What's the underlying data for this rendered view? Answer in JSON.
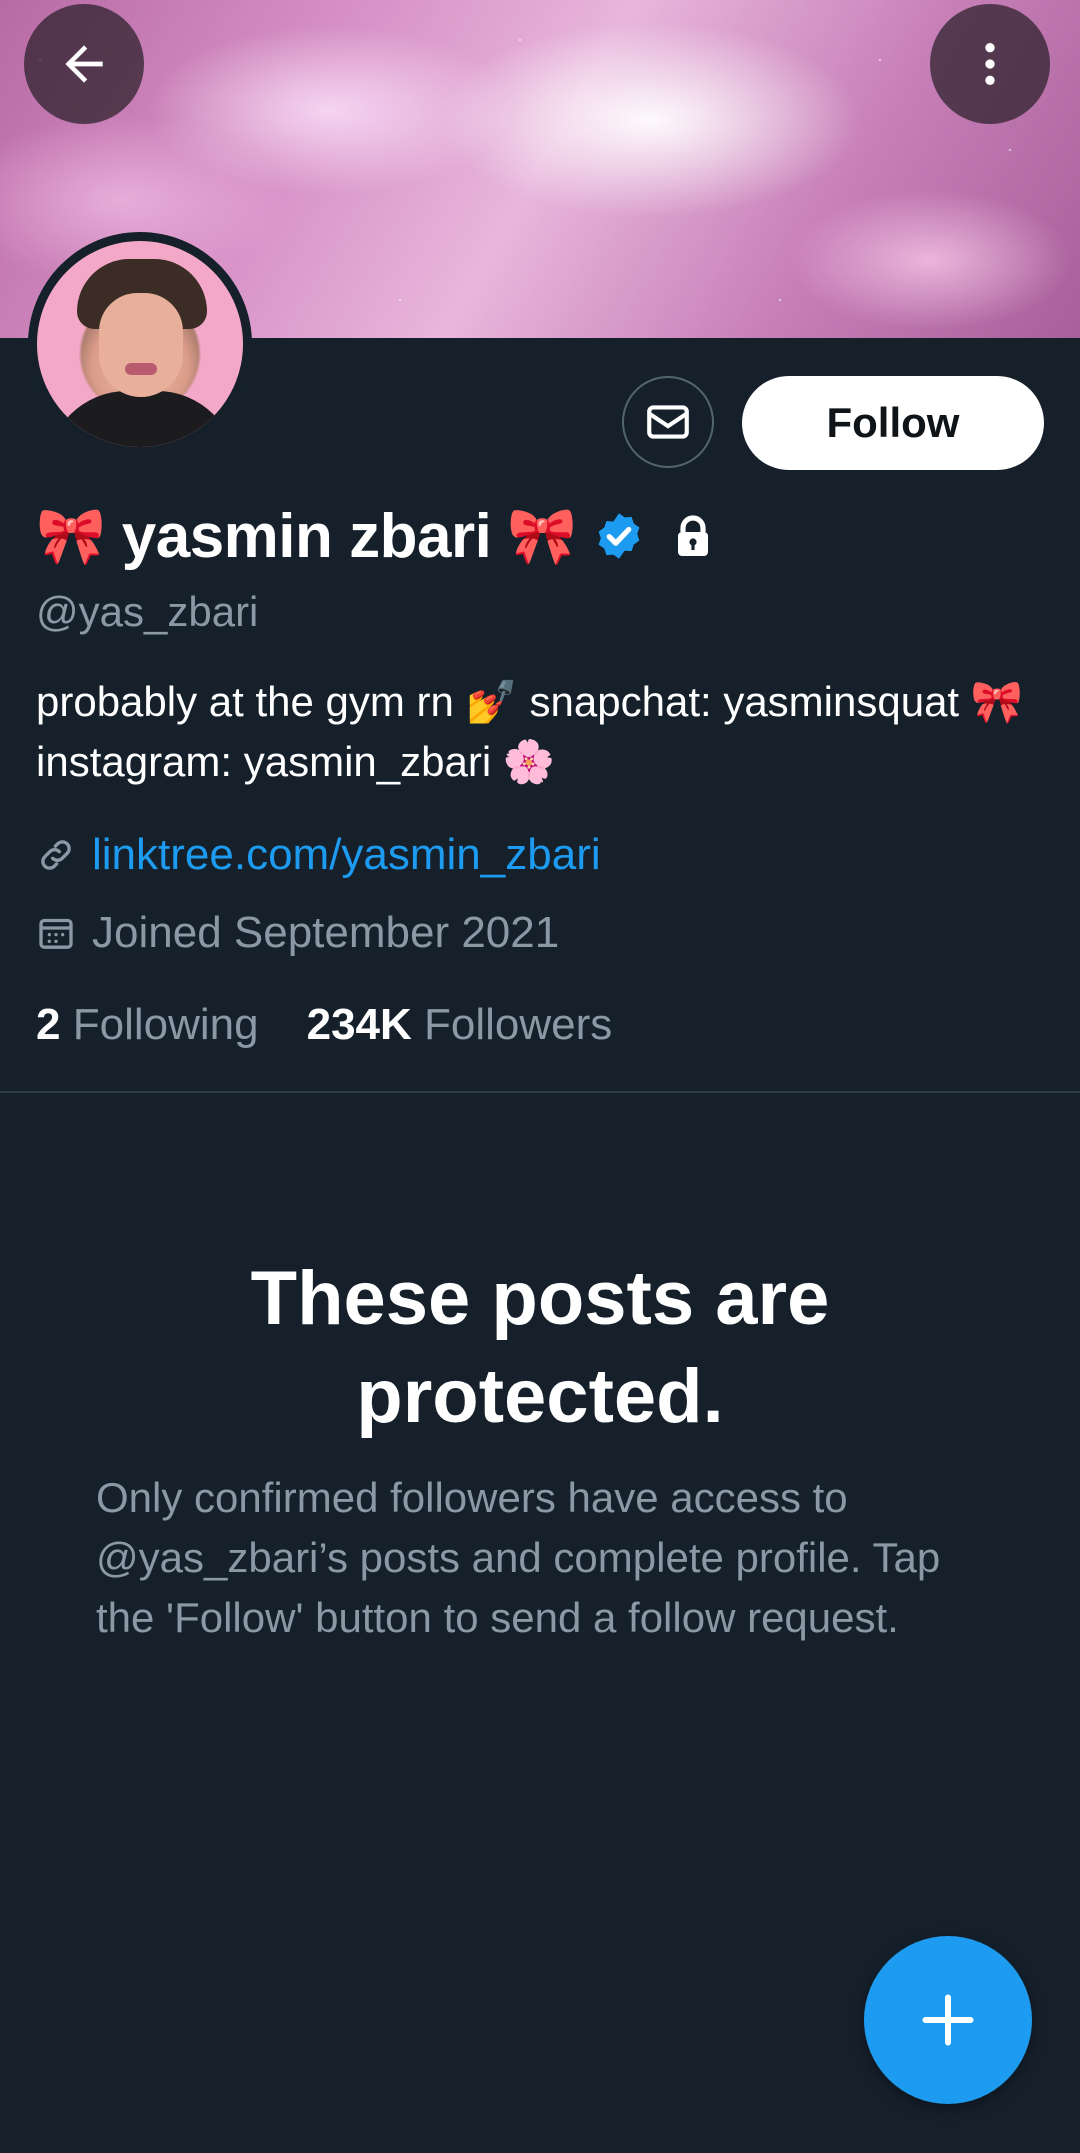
{
  "header": {
    "back_icon": "arrow-left-icon",
    "more_icon": "more-vertical-icon"
  },
  "profile": {
    "display_name": "yasmin zbari",
    "name_emoji_left": "🎀",
    "name_emoji_right": "🎀",
    "verified_icon": "verified-badge-icon",
    "protected_icon": "lock-icon",
    "handle": "@yas_zbari",
    "bio": "probably at the gym rn 💅 snapchat: yasminsquat 🎀 instagram: yasmin_zbari 🌸",
    "link": "linktree.com/yasmin_zbari",
    "joined": "Joined September 2021",
    "following_count": "2",
    "following_label": "Following",
    "followers_count": "234K",
    "followers_label": "Followers"
  },
  "actions": {
    "message_icon": "mail-icon",
    "follow_label": "Follow"
  },
  "protected": {
    "title": "These posts are protected.",
    "text": "Only confirmed followers have access to @yas_zbari’s posts and complete profile. Tap the 'Follow' button to send a follow request."
  },
  "fab": {
    "icon": "plus-icon"
  },
  "colors": {
    "background": "#15202b",
    "accent": "#1d9bf0",
    "secondary_text": "#8b98a5"
  }
}
